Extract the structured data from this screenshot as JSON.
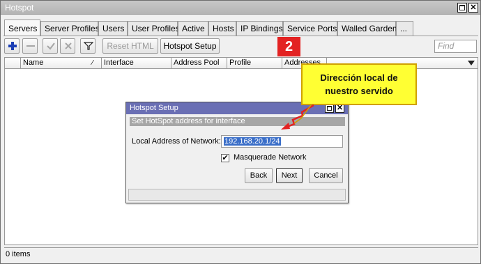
{
  "window": {
    "title": "Hotspot"
  },
  "tabs": [
    {
      "label": "Servers",
      "active": true
    },
    {
      "label": "Server Profiles"
    },
    {
      "label": "Users"
    },
    {
      "label": "User Profiles"
    },
    {
      "label": "Active"
    },
    {
      "label": "Hosts"
    },
    {
      "label": "IP Bindings"
    },
    {
      "label": "Service Ports"
    },
    {
      "label": "Walled Garden"
    },
    {
      "label": "..."
    }
  ],
  "toolbar": {
    "add_icon": "plus-icon",
    "remove_icon": "minus-icon",
    "enable_icon": "check-icon",
    "disable_icon": "x-icon",
    "filter_icon": "filter-icon",
    "reset_html_label": "Reset HTML",
    "hotspot_setup_label": "Hotspot Setup",
    "find_placeholder": "Find"
  },
  "table": {
    "columns": [
      "Name",
      "Interface",
      "Address Pool",
      "Profile",
      "Addresses"
    ]
  },
  "status": {
    "items": "0 items"
  },
  "dialog": {
    "title": "Hotspot Setup",
    "subtitle": "Set HotSpot address for interface",
    "local_address_label": "Local Address of Network:",
    "local_address_value": "192.168.20.1/24",
    "masquerade_label": "Masquerade Network",
    "masquerade_checked": true,
    "back_label": "Back",
    "next_label": "Next",
    "cancel_label": "Cancel"
  },
  "annotation": {
    "step_number": "2",
    "callout_line1": "Dirección local de",
    "callout_line2": "nuestro servido",
    "callout_color": "#ffff33",
    "step_color": "#e32222",
    "arrow_color": "#e32222"
  }
}
